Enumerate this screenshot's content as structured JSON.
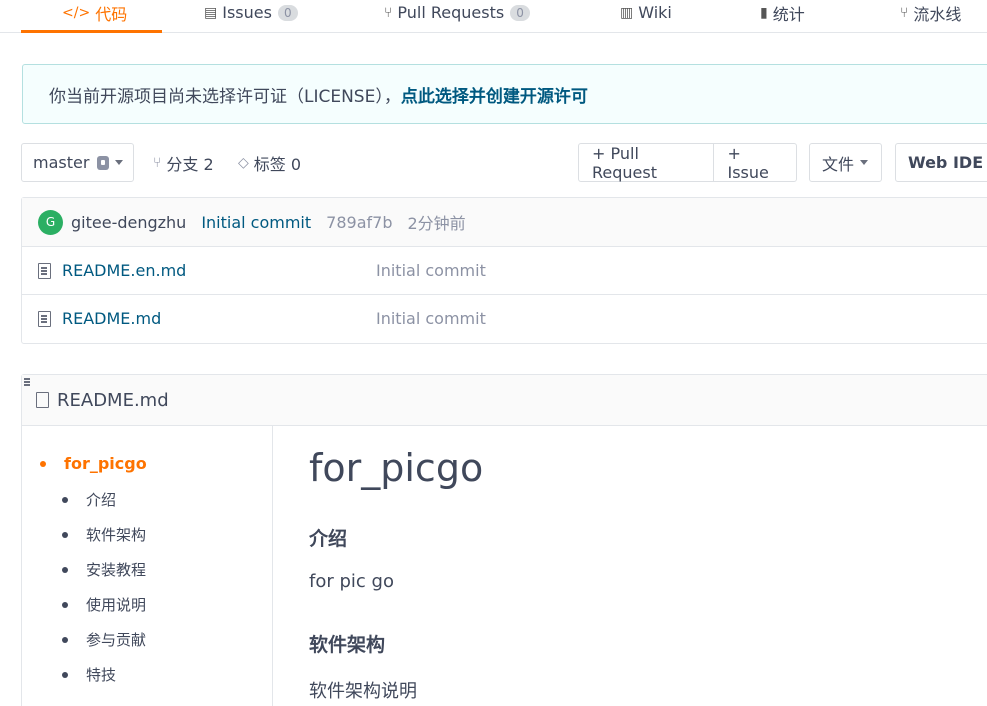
{
  "tabs": [
    {
      "icon": "</>",
      "label": "代码",
      "active": true
    },
    {
      "icon": "▤",
      "label": "Issues",
      "badge": "0"
    },
    {
      "icon": "⑂",
      "label": "Pull Requests",
      "badge": "0"
    },
    {
      "icon": "▥",
      "label": "Wiki"
    },
    {
      "icon": "▮",
      "label": "统计"
    },
    {
      "icon": "⑂",
      "label": "流水线"
    }
  ],
  "notice": {
    "text": "你当前开源项目尚未选择许可证（LICENSE），",
    "link": "点此选择并创建开源许可"
  },
  "toolbar": {
    "branch": "master",
    "branches_label": "分支 2",
    "tags_label": "标签 0",
    "pull_request": "+ Pull Request",
    "issue": "+ Issue",
    "file": "文件",
    "web_ide": "Web IDE"
  },
  "commit": {
    "avatar_letter": "G",
    "author": "gitee-dengzhu",
    "message": "Initial commit",
    "sha": "789af7b",
    "time": "2分钟前"
  },
  "files": [
    {
      "name": "README.en.md",
      "message": "Initial commit"
    },
    {
      "name": "README.md",
      "message": "Initial commit"
    }
  ],
  "readme": {
    "title": "README.md",
    "toc_top": "for_picgo",
    "toc_items": [
      "介绍",
      "软件架构",
      "安装教程",
      "使用说明",
      "参与贡献",
      "特技"
    ],
    "h1": "for_picgo",
    "h2_intro": "介绍",
    "p_intro": "for pic go",
    "h2_arch": "软件架构",
    "p_arch": "软件架构说明"
  },
  "colors": {
    "accent": "#fe7300",
    "link": "#005980",
    "avatar": "#2baf63"
  }
}
